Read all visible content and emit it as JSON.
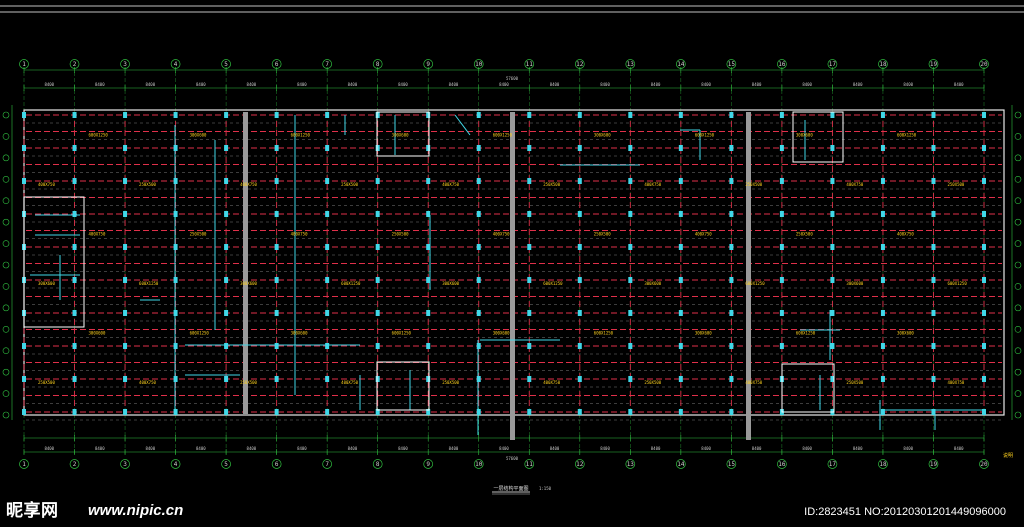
{
  "drawing": {
    "title": "一层结构平面图",
    "scale": "1:150",
    "overall_dimension": "57600",
    "span_dimension": "8400",
    "notes_label": "说明"
  },
  "grid_axes": {
    "columns": [
      "1",
      "2",
      "3",
      "4",
      "5",
      "6",
      "7",
      "8",
      "9",
      "10",
      "11",
      "12",
      "13",
      "14",
      "15",
      "16",
      "17",
      "18",
      "19",
      "20"
    ],
    "rows": [
      "A",
      "B",
      "C",
      "D",
      "E",
      "F",
      "G",
      "H",
      "J",
      "K",
      "L",
      "M",
      "N",
      "P",
      "Q"
    ]
  },
  "beam_labels": [
    "400X750",
    "300X600",
    "250X500",
    "600X1250"
  ],
  "colors": {
    "background": "#000000",
    "beam_dashed": "#e0304a",
    "wall": "#40d8e8",
    "dimension": "#30c040",
    "grid_bubble": "#30c040",
    "text": "#ffd21e",
    "frame": "#ffffff"
  },
  "watermark": {
    "logo": "昵享网",
    "url": "www.nipic.cn",
    "id_text": "ID:2823451 NO:20120301201449096000"
  }
}
